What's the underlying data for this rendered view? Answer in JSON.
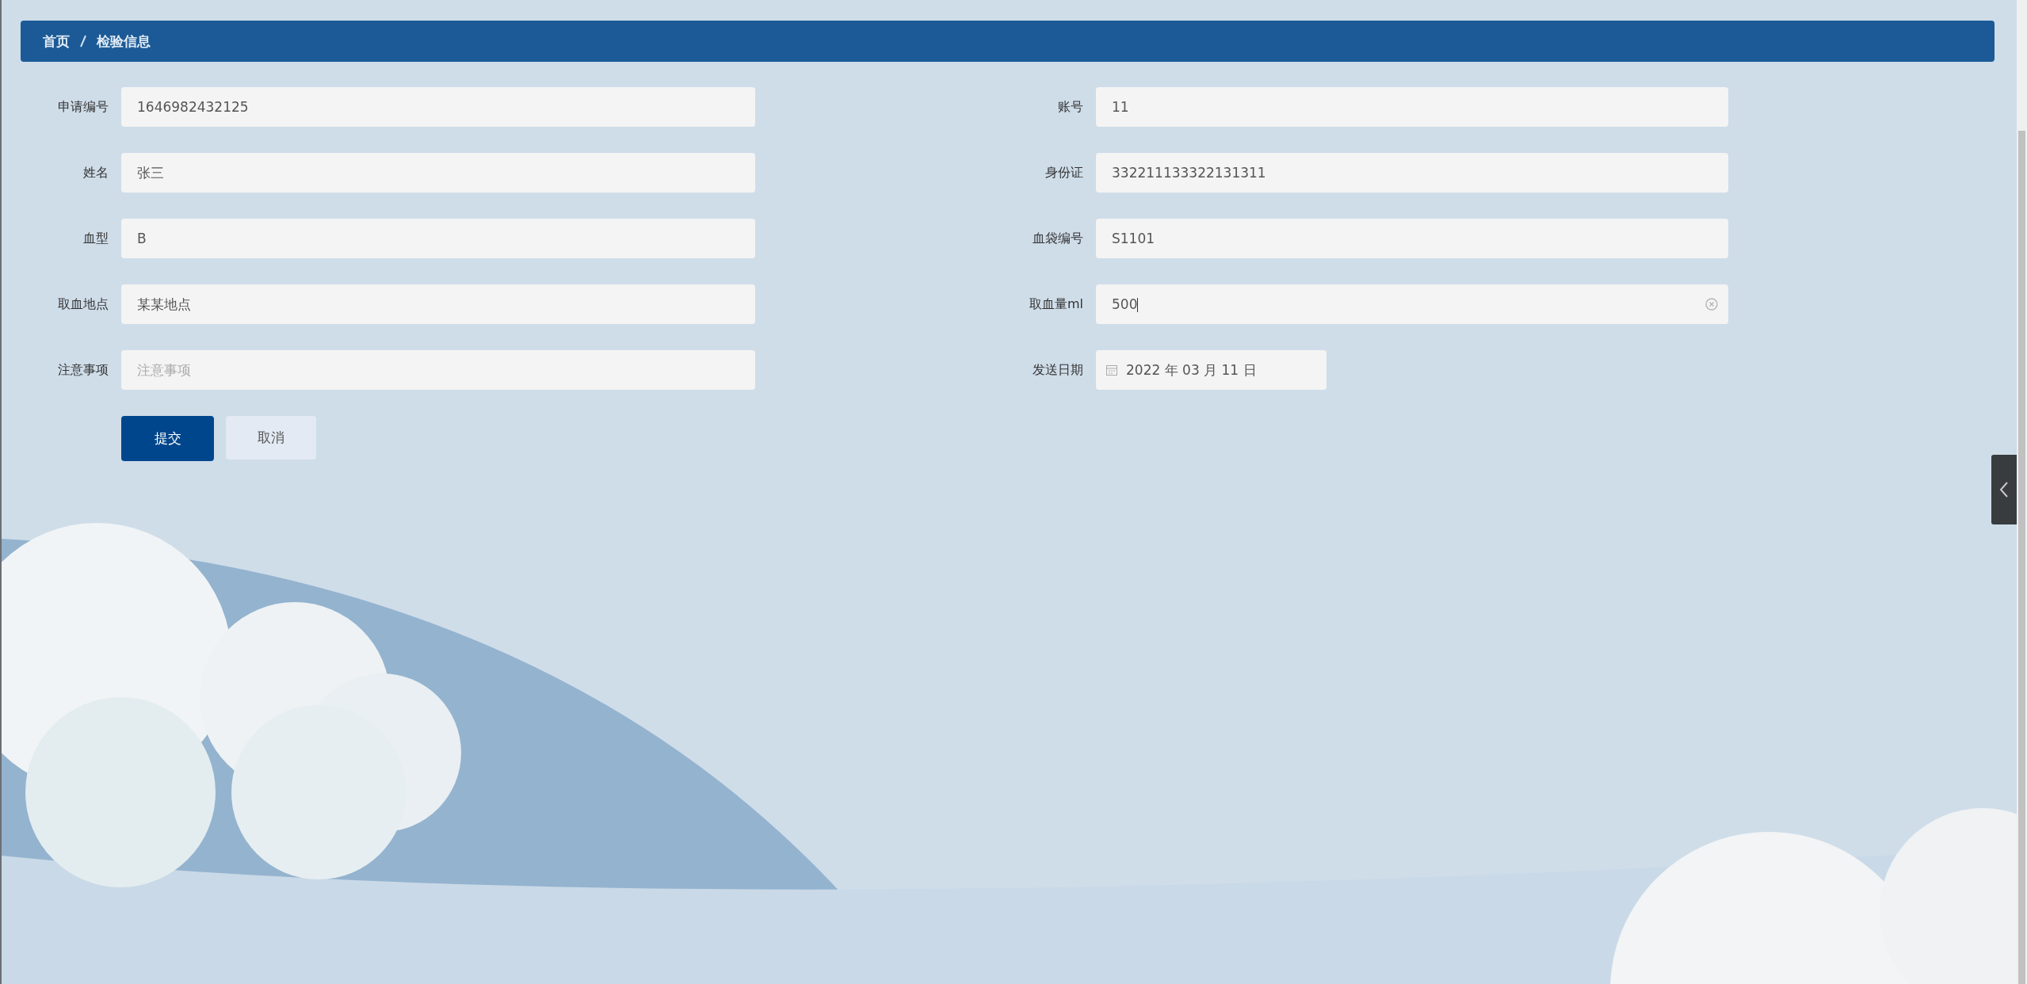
{
  "breadcrumb": [
    {
      "label": "首页"
    },
    {
      "label": "检验信息"
    }
  ],
  "rows": [
    [
      {
        "kind": "text",
        "label": "申请编号",
        "value": "1646982432125",
        "focused": false
      },
      {
        "kind": "text",
        "label": "账号",
        "value": "11",
        "focused": false
      }
    ],
    [
      {
        "kind": "text",
        "label": "姓名",
        "value": "张三",
        "focused": false
      },
      {
        "kind": "text",
        "label": "身份证",
        "value": "332211133322131311",
        "focused": false
      }
    ],
    [
      {
        "kind": "text",
        "label": "血型",
        "value": "B",
        "focused": false
      },
      {
        "kind": "text",
        "label": "血袋编号",
        "value": "S1101",
        "focused": false
      }
    ],
    [
      {
        "kind": "text",
        "label": "取血地点",
        "value": "某某地点",
        "focused": false
      },
      {
        "kind": "text",
        "label": "取血量ml",
        "value": "500",
        "focused": true
      }
    ],
    [
      {
        "kind": "text",
        "label": "注意事项",
        "placeholder": "注意事项",
        "focused": false
      },
      {
        "kind": "date",
        "label": "发送日期",
        "value": "2022 年 03 月 11 日",
        "focused": false
      }
    ]
  ],
  "buttons": [
    {
      "kind": "primary",
      "label": "提交"
    },
    {
      "kind": "secondary",
      "label": "取消"
    }
  ]
}
